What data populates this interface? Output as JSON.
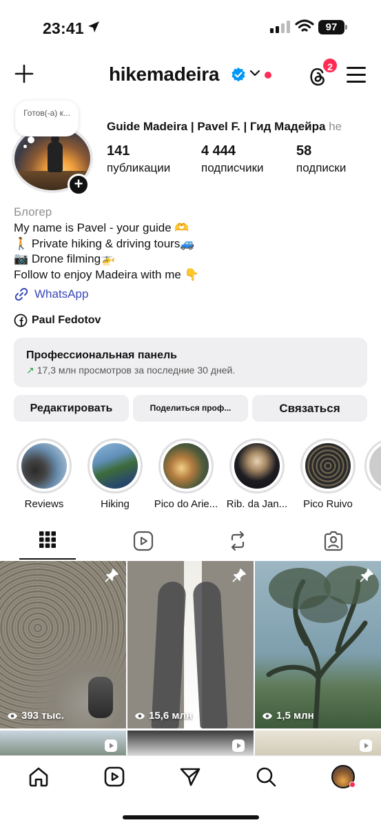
{
  "status_bar": {
    "time": "23:41",
    "battery": "97"
  },
  "header": {
    "username": "hikemadeira",
    "notifications_badge": "2"
  },
  "profile": {
    "note_text": "Готов(-а) к...",
    "full_name": "Guide Madeira | Pavel F. | Гид Мадейра",
    "full_name_overflow": "he",
    "stats": [
      {
        "number": "141",
        "label": "публикации"
      },
      {
        "number": "4 444",
        "label": "подписчики"
      },
      {
        "number": "58",
        "label": "подписки"
      }
    ],
    "category": "Блогер",
    "bio_lines": [
      "My name is Pavel - your guide 🫶",
      "🚶 Private hiking & driving tours🚙",
      "📷 Drone filming🚁",
      "Follow to enjoy Madeira with me 👇"
    ],
    "link_text": "WhatsApp",
    "facebook_name": "Paul Fedotov"
  },
  "pro_panel": {
    "title": "Профессиональная панель",
    "subtitle": "17,3 млн просмотров за последние 30 дней."
  },
  "buttons": {
    "edit": "Редактировать",
    "share": "Поделиться проф...",
    "contact": "Связаться"
  },
  "highlights": [
    {
      "label": "Reviews"
    },
    {
      "label": "Hiking"
    },
    {
      "label": "Pico do Arie..."
    },
    {
      "label": "Rib. da Jan..."
    },
    {
      "label": "Pico Ruivo"
    }
  ],
  "posts": [
    {
      "views": "393 тыс.",
      "pinned": true
    },
    {
      "views": "15,6 млн",
      "pinned": true
    },
    {
      "views": "1,5 млн",
      "pinned": true
    }
  ],
  "colors": {
    "accent_red": "#ff2d55",
    "link_blue": "#3847b8",
    "verified_blue": "#0095f6",
    "panel_bg": "#efeff1"
  }
}
